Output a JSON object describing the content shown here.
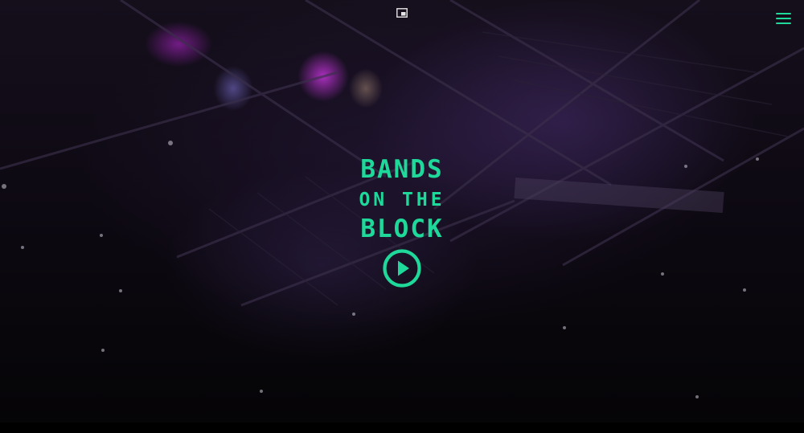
{
  "hero": {
    "title_line_1": "BANDS",
    "title_line_2": "ON THE",
    "title_line_3": "BLOCK"
  },
  "icons": {
    "pip": "picture-in-picture-icon",
    "menu": "hamburger-menu-icon",
    "play": "play-circle-icon"
  },
  "colors": {
    "accent": "#1ed99a",
    "background": "#0d0912",
    "pip_icon": "#e6e6e6"
  }
}
